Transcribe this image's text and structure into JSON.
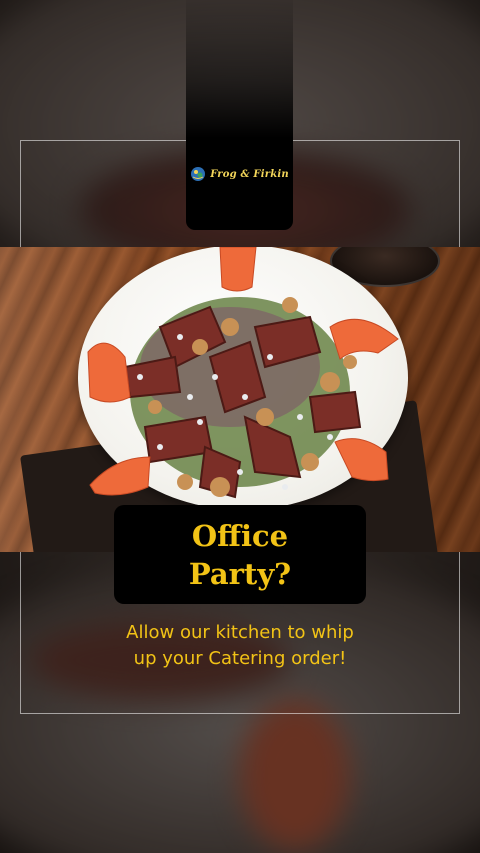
{
  "logo": {
    "text": "Frog & Firkin"
  },
  "headline": {
    "line1": "Office",
    "line2": "Party?"
  },
  "tagline": {
    "line1": "Allow our kitchen to whip",
    "line2": "up your Catering order!"
  },
  "colors": {
    "accent": "#f2c316",
    "card": "#000000",
    "logo_text": "#f3d65a"
  },
  "icons": {
    "logo_mark": "frog-logo-icon"
  }
}
